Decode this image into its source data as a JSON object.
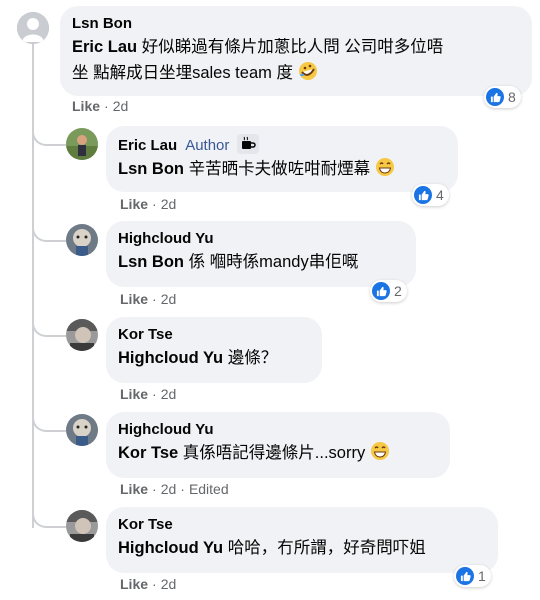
{
  "colors": {
    "bubble": "#f0f2f5",
    "secondary": "#65676b",
    "link": "#385898",
    "like_blue": "#1b74e4",
    "line": "#ced0d4"
  },
  "comments": [
    {
      "author": "Lsn Bon",
      "mention": "Eric Lau",
      "text_line1": " 好似睇過有條片加蔥比人問 公司咁多位唔",
      "text_line2": "坐 點解成日坐埋sales team 度",
      "emoji": "rofl-emoji",
      "like": "Like",
      "time": "2d",
      "reactions": "8"
    },
    {
      "author": "Eric Lau",
      "badge": "Author",
      "mention": "Lsn Bon",
      "text": " 辛苦晒卡夫做咗咁耐煙幕",
      "emoji": "grin-emoji",
      "like": "Like",
      "time": "2d",
      "reactions": "4"
    },
    {
      "author": "Highcloud Yu",
      "mention": "Lsn Bon",
      "text": " 係 嗰時係mandy串佢嘅",
      "like": "Like",
      "time": "2d",
      "reactions": "2"
    },
    {
      "author": "Kor Tse",
      "mention": "Highcloud Yu",
      "text": " 邊條？",
      "like": "Like",
      "time": "2d"
    },
    {
      "author": "Highcloud Yu",
      "mention": "Kor Tse",
      "text": " 真係唔記得邊條片...sorry",
      "emoji": "grin-emoji",
      "like": "Like",
      "time": "2d",
      "edited": "Edited"
    },
    {
      "author": "Kor Tse",
      "mention": "Highcloud Yu",
      "text": " 哈哈，冇所謂，好奇問吓姐",
      "like": "Like",
      "time": "2d",
      "reactions": "1"
    }
  ]
}
